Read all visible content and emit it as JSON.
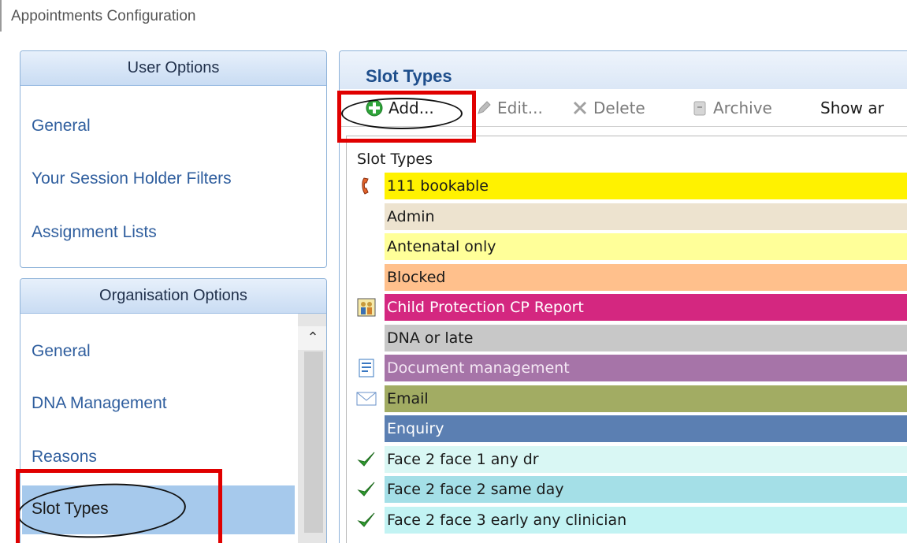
{
  "window": {
    "title": "Appointments Configuration"
  },
  "user_options": {
    "header": "User Options",
    "items": [
      {
        "label": "General"
      },
      {
        "label": "Your Session Holder Filters"
      },
      {
        "label": "Assignment Lists"
      }
    ]
  },
  "organisation_options": {
    "header": "Organisation Options",
    "items": [
      {
        "label": "General"
      },
      {
        "label": "DNA Management"
      },
      {
        "label": "Reasons"
      },
      {
        "label": "Slot Types"
      }
    ],
    "selected": "Slot Types"
  },
  "slot_types": {
    "title": "Slot Types",
    "toolbar": {
      "add": "Add...",
      "edit": "Edit...",
      "delete": "Delete",
      "archive": "Archive",
      "show": "Show ar"
    },
    "list_caption": "Slot Types",
    "rows": [
      {
        "label": "111 bookable",
        "bg": "#fff200",
        "fg": "#1a1a1a",
        "icon": "phone-icon"
      },
      {
        "label": "Admin",
        "bg": "#ede3cf",
        "fg": "#1a1a1a",
        "icon": ""
      },
      {
        "label": "Antenatal only",
        "bg": "#ffff99",
        "fg": "#1a1a1a",
        "icon": ""
      },
      {
        "label": "Blocked",
        "bg": "#ffc08c",
        "fg": "#1a1a1a",
        "icon": ""
      },
      {
        "label": "Child Protection CP Report",
        "bg": "#d42780",
        "fg": "#ffffff",
        "icon": "family-icon"
      },
      {
        "label": "DNA or late",
        "bg": "#c8c8c8",
        "fg": "#1a1a1a",
        "icon": ""
      },
      {
        "label": "Document management",
        "bg": "#a674a8",
        "fg": "#f4e7f4",
        "icon": "document-icon"
      },
      {
        "label": "Email",
        "bg": "#a2ac63",
        "fg": "#1a1a1a",
        "icon": "envelope-icon"
      },
      {
        "label": "Enquiry",
        "bg": "#5b7fb2",
        "fg": "#ffffff",
        "icon": ""
      },
      {
        "label": "Face 2 face 1 any dr",
        "bg": "#d9f7f4",
        "fg": "#1a1a1a",
        "icon": "checkmark-icon"
      },
      {
        "label": "Face 2 face 2 same day",
        "bg": "#a4dfe7",
        "fg": "#1a1a1a",
        "icon": "checkmark-icon"
      },
      {
        "label": "Face 2 face 3 early any clinician",
        "bg": "#c2f3f3",
        "fg": "#1a1a1a",
        "icon": "checkmark-icon"
      }
    ]
  },
  "colors": {
    "link": "#2f5e9e",
    "header_text": "#1e4e8c",
    "selection": "#a6c9ec",
    "annotation": "#e00000"
  }
}
